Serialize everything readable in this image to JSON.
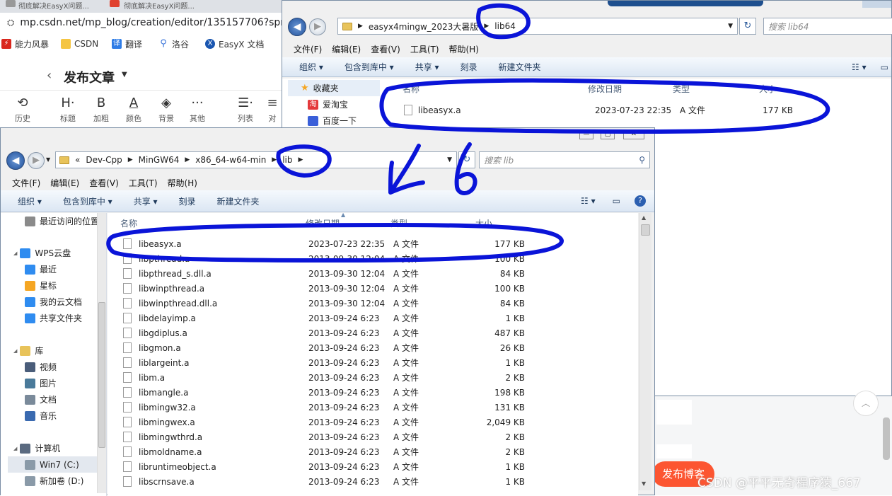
{
  "browser": {
    "tabs": [
      "彻底解决EasyX问题...",
      "彻底解决EasyX问题..."
    ],
    "url": "mp.csdn.net/mp_blog/creation/editor/135157706?spm",
    "bookmarks": [
      {
        "label": "能力风暴",
        "icon": "storm-icon",
        "color": "#d9261c"
      },
      {
        "label": "CSDN",
        "icon": "folder-icon",
        "color": "#f5c542"
      },
      {
        "label": "翻译",
        "icon": "translate-icon",
        "color": "#2e7ce6"
      },
      {
        "label": "洛谷",
        "icon": "luogu-icon",
        "color": "#3a74d9"
      },
      {
        "label": "EasyX 文档",
        "icon": "easyx-icon",
        "color": "#1a56b0"
      }
    ],
    "page_title": "发布文章",
    "toolbar": [
      {
        "label": "历史",
        "glyph": "⟲"
      },
      {
        "label": "标题",
        "glyph": "H·"
      },
      {
        "label": "加粗",
        "glyph": "B"
      },
      {
        "label": "颜色",
        "glyph": "A"
      },
      {
        "label": "背景",
        "glyph": "◈"
      },
      {
        "label": "其他",
        "glyph": "···"
      },
      {
        "label": "列表",
        "glyph": "☰·"
      },
      {
        "label": "对",
        "glyph": "≡"
      }
    ],
    "publish_button": "发布博客",
    "watermark": "CSDN @平平无奇程序猿_667"
  },
  "back_window": {
    "path": [
      "easyx4mingw_2023大暑版",
      "lib64"
    ],
    "search_placeholder": "搜索 lib64",
    "menu": [
      "文件(F)",
      "编辑(E)",
      "查看(V)",
      "工具(T)",
      "帮助(H)"
    ],
    "commands": [
      "组织 ▾",
      "包含到库中 ▾",
      "共享 ▾",
      "刻录",
      "新建文件夹"
    ],
    "nav": [
      {
        "label": "收藏夹",
        "icon": "star-icon"
      },
      {
        "label": "爱淘宝",
        "icon": "taobao-icon"
      },
      {
        "label": "百度一下",
        "icon": "baidu-icon"
      }
    ],
    "columns": [
      "名称",
      "修改日期",
      "类型",
      "大小"
    ],
    "files": [
      {
        "name": "libeasyx.a",
        "date": "2023-07-23 22:35",
        "type": "A 文件",
        "size": "177 KB"
      }
    ]
  },
  "front_window": {
    "path": [
      "«",
      "Dev-Cpp",
      "MinGW64",
      "x86_64-w64-mingw32",
      "lib"
    ],
    "search_placeholder": "搜索 lib",
    "menu": [
      "文件(F)",
      "编辑(E)",
      "查看(V)",
      "工具(T)",
      "帮助(H)"
    ],
    "commands": [
      "组织 ▾",
      "包含到库中 ▾",
      "共享 ▾",
      "刻录",
      "新建文件夹"
    ],
    "nav": [
      {
        "label": "最近访问的位置",
        "icon": "recent-icon",
        "color": "#8a8a8a",
        "indent": 1
      },
      {
        "label": "WPS云盘",
        "icon": "wps-cloud-icon",
        "color": "#2f8cf0",
        "indent": 0
      },
      {
        "label": "最近",
        "icon": "clock-icon",
        "color": "#2f8cf0",
        "indent": 1
      },
      {
        "label": "星标",
        "icon": "star-icon",
        "color": "#f5a623",
        "indent": 1
      },
      {
        "label": "我的云文档",
        "icon": "cloud-doc-icon",
        "color": "#2f8cf0",
        "indent": 1
      },
      {
        "label": "共享文件夹",
        "icon": "share-folder-icon",
        "color": "#2f8cf0",
        "indent": 1
      },
      {
        "label": "库",
        "icon": "library-icon",
        "color": "#e8c35a",
        "indent": 0
      },
      {
        "label": "视频",
        "icon": "video-icon",
        "color": "#4a5d7a",
        "indent": 1
      },
      {
        "label": "图片",
        "icon": "picture-icon",
        "color": "#4a7a9a",
        "indent": 1
      },
      {
        "label": "文档",
        "icon": "document-icon",
        "color": "#7a8a9a",
        "indent": 1
      },
      {
        "label": "音乐",
        "icon": "music-icon",
        "color": "#3a6ab0",
        "indent": 1
      },
      {
        "label": "计算机",
        "icon": "computer-icon",
        "color": "#5a6a80",
        "indent": 0
      },
      {
        "label": "Win7 (C:)",
        "icon": "drive-icon",
        "color": "#8a9aa8",
        "indent": 1
      },
      {
        "label": "新加卷 (D:)",
        "icon": "drive-icon",
        "color": "#8a9aa8",
        "indent": 1
      }
    ],
    "columns": [
      "名称",
      "修改日期",
      "类型",
      "大小"
    ],
    "files": [
      {
        "name": "libeasyx.a",
        "date": "2023-07-23 22:35",
        "type": "A 文件",
        "size": "177 KB"
      },
      {
        "name": "libpthread.a",
        "date": "2013-09-30 12:04",
        "type": "A 文件",
        "size": "100 KB"
      },
      {
        "name": "libpthread_s.dll.a",
        "date": "2013-09-30 12:04",
        "type": "A 文件",
        "size": "84 KB"
      },
      {
        "name": "libwinpthread.a",
        "date": "2013-09-30 12:04",
        "type": "A 文件",
        "size": "100 KB"
      },
      {
        "name": "libwinpthread.dll.a",
        "date": "2013-09-30 12:04",
        "type": "A 文件",
        "size": "84 KB"
      },
      {
        "name": "libdelayimp.a",
        "date": "2013-09-24 6:23",
        "type": "A 文件",
        "size": "1 KB"
      },
      {
        "name": "libgdiplus.a",
        "date": "2013-09-24 6:23",
        "type": "A 文件",
        "size": "487 KB"
      },
      {
        "name": "libgmon.a",
        "date": "2013-09-24 6:23",
        "type": "A 文件",
        "size": "26 KB"
      },
      {
        "name": "liblargeint.a",
        "date": "2013-09-24 6:23",
        "type": "A 文件",
        "size": "1 KB"
      },
      {
        "name": "libm.a",
        "date": "2013-09-24 6:23",
        "type": "A 文件",
        "size": "2 KB"
      },
      {
        "name": "libmangle.a",
        "date": "2013-09-24 6:23",
        "type": "A 文件",
        "size": "198 KB"
      },
      {
        "name": "libmingw32.a",
        "date": "2013-09-24 6:23",
        "type": "A 文件",
        "size": "131 KB"
      },
      {
        "name": "libmingwex.a",
        "date": "2013-09-24 6:23",
        "type": "A 文件",
        "size": "2,049 KB"
      },
      {
        "name": "libmingwthrd.a",
        "date": "2013-09-24 6:23",
        "type": "A 文件",
        "size": "2 KB"
      },
      {
        "name": "libmoldname.a",
        "date": "2013-09-24 6:23",
        "type": "A 文件",
        "size": "2 KB"
      },
      {
        "name": "libruntimeobject.a",
        "date": "2013-09-24 6:23",
        "type": "A 文件",
        "size": "1 KB"
      },
      {
        "name": "libscrnsave.a",
        "date": "2013-09-24 6:23",
        "type": "A 文件",
        "size": "1 KB"
      }
    ]
  },
  "annotation": {
    "digit": "6",
    "ink_color": "#0a14d8"
  }
}
